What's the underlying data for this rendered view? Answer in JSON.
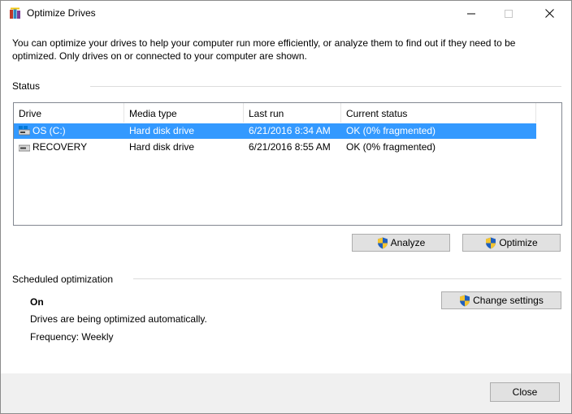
{
  "window": {
    "title": "Optimize Drives",
    "icon": "defrag-app-icon",
    "controls": [
      "minimize-icon",
      "maximize-icon",
      "close-icon"
    ]
  },
  "intro_text": "You can optimize your drives to help your computer run more efficiently, or analyze them to find out if they need to be optimized. Only drives on or connected to your computer are shown.",
  "status": {
    "label": "Status",
    "columns": [
      "Drive",
      "Media type",
      "Last run",
      "Current status"
    ],
    "drives": [
      {
        "name": "OS (C:)",
        "media_type": "Hard disk drive",
        "last_run": "6/21/2016 8:34 AM",
        "current_status": "OK (0% fragmented)",
        "selected": true,
        "icon": "windows-drive-icon"
      },
      {
        "name": "RECOVERY",
        "media_type": "Hard disk drive",
        "last_run": "6/21/2016 8:55 AM",
        "current_status": "OK (0% fragmented)",
        "selected": false,
        "icon": "drive-icon"
      }
    ],
    "analyze_label": "Analyze",
    "optimize_label": "Optimize"
  },
  "scheduled": {
    "label": "Scheduled optimization",
    "state": "On",
    "description": "Drives are being optimized automatically.",
    "frequency": "Frequency: Weekly",
    "change_settings_label": "Change settings"
  },
  "footer": {
    "close_label": "Close"
  },
  "colors": {
    "selection": "#3399ff",
    "button_face": "#e1e1e1",
    "footer_bg": "#f0f0f0"
  }
}
